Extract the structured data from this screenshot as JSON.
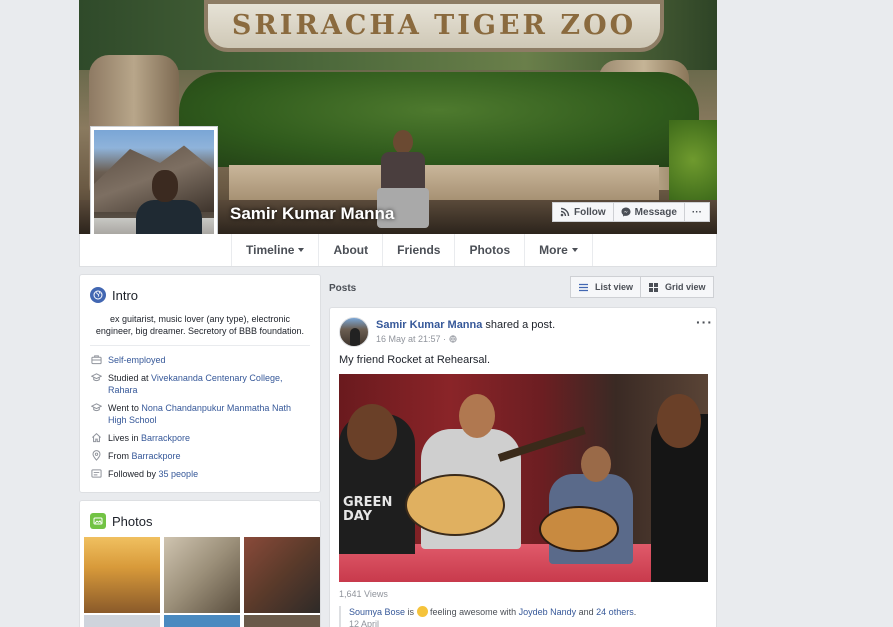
{
  "cover": {
    "sign_text": "SRIRACHA TIGER ZOO",
    "profile_name": "Samir Kumar Manna",
    "follow_label": "Follow",
    "message_label": "Message",
    "more_label": "···"
  },
  "nav": {
    "tabs": [
      {
        "label": "Timeline",
        "has_caret": true
      },
      {
        "label": "About"
      },
      {
        "label": "Friends"
      },
      {
        "label": "Photos"
      },
      {
        "label": "More",
        "has_caret": true
      }
    ]
  },
  "intro": {
    "title": "Intro",
    "bio": "ex guitarist, music lover (any type), electronic engineer, big dreamer. Secretory of BBB foundation.",
    "items": [
      {
        "icon": "briefcase-icon",
        "prefix": "",
        "link": "Self-employed",
        "suffix": ""
      },
      {
        "icon": "graduation-cap-icon",
        "prefix": "Studied at ",
        "link": "Vivekananda Centenary College, Rahara",
        "suffix": ""
      },
      {
        "icon": "graduation-cap-icon",
        "prefix": "Went to ",
        "link": "Nona Chandanpukur Manmatha Nath High School",
        "suffix": ""
      },
      {
        "icon": "home-icon",
        "prefix": "Lives in ",
        "link": "Barrackpore",
        "suffix": ""
      },
      {
        "icon": "location-pin-icon",
        "prefix": "From ",
        "link": "Barrackpore",
        "suffix": ""
      },
      {
        "icon": "followers-icon",
        "prefix": "Followed by ",
        "link": "35 people",
        "suffix": ""
      }
    ]
  },
  "photos": {
    "title": "Photos"
  },
  "posts": {
    "label": "Posts",
    "list_view": "List view",
    "grid_view": "Grid view"
  },
  "post": {
    "author": "Samir Kumar Manna",
    "action": " shared a post.",
    "time": "16 May at 21:57 ·",
    "more": "···",
    "caption": "My friend Rocket at Rehearsal.",
    "shirt_text": "GREEN\nDAY",
    "views": "1,641 Views",
    "shared_author": "Soumya Bose",
    "shared_is": " is ",
    "shared_feeling": " feeling awesome with ",
    "shared_with": "Joydeb Nandy",
    "shared_and": " and ",
    "shared_others": "24 others",
    "shared_end": ".",
    "shared_date": "12 April"
  },
  "colors": {
    "link": "#365899",
    "background": "#e9ebee",
    "intro_icon": "#4267b2",
    "photos_icon": "#72c344"
  }
}
